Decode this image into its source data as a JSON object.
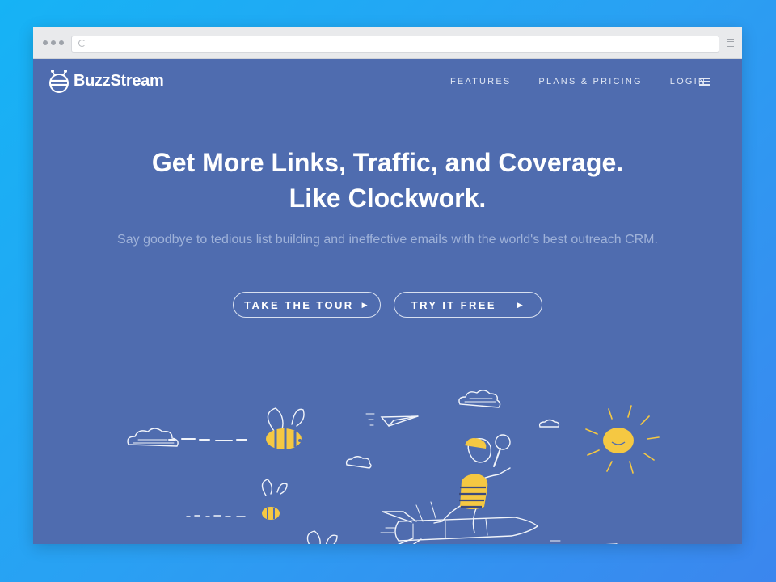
{
  "brand": {
    "name": "BuzzStream"
  },
  "nav": {
    "items": [
      {
        "label": "FEATURES"
      },
      {
        "label": "PLANS & PRICING"
      },
      {
        "label": "LOGIN"
      }
    ]
  },
  "hero": {
    "title_line1": "Get More Links, Traffic, and Coverage.",
    "title_line2": "Like Clockwork.",
    "subtitle": "Say goodbye to tedious list building and ineffective emails with the world's best outreach CRM."
  },
  "buttons": {
    "tour_label": "TAKE THE TOUR",
    "free_label": "TRY IT FREE"
  },
  "icons": {
    "arrow": "play-arrow-icon",
    "menu": "hamburger-menu-icon"
  },
  "colors": {
    "page_bg": "#4f6caf",
    "accent_yellow": "#f5c842",
    "outer_bg": "#2aa0f3"
  }
}
